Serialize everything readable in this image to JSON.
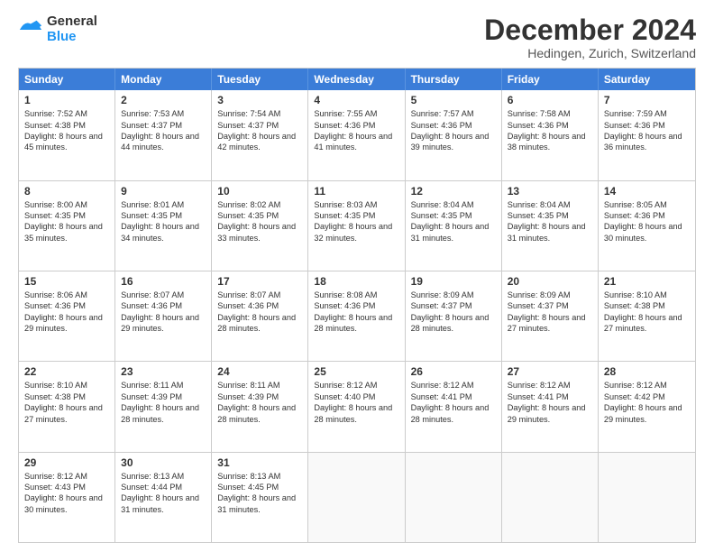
{
  "header": {
    "logo_general": "General",
    "logo_blue": "Blue",
    "month_title": "December 2024",
    "location": "Hedingen, Zurich, Switzerland"
  },
  "days_of_week": [
    "Sunday",
    "Monday",
    "Tuesday",
    "Wednesday",
    "Thursday",
    "Friday",
    "Saturday"
  ],
  "weeks": [
    [
      {
        "day": "1",
        "sunrise": "Sunrise: 7:52 AM",
        "sunset": "Sunset: 4:38 PM",
        "daylight": "Daylight: 8 hours and 45 minutes."
      },
      {
        "day": "2",
        "sunrise": "Sunrise: 7:53 AM",
        "sunset": "Sunset: 4:37 PM",
        "daylight": "Daylight: 8 hours and 44 minutes."
      },
      {
        "day": "3",
        "sunrise": "Sunrise: 7:54 AM",
        "sunset": "Sunset: 4:37 PM",
        "daylight": "Daylight: 8 hours and 42 minutes."
      },
      {
        "day": "4",
        "sunrise": "Sunrise: 7:55 AM",
        "sunset": "Sunset: 4:36 PM",
        "daylight": "Daylight: 8 hours and 41 minutes."
      },
      {
        "day": "5",
        "sunrise": "Sunrise: 7:57 AM",
        "sunset": "Sunset: 4:36 PM",
        "daylight": "Daylight: 8 hours and 39 minutes."
      },
      {
        "day": "6",
        "sunrise": "Sunrise: 7:58 AM",
        "sunset": "Sunset: 4:36 PM",
        "daylight": "Daylight: 8 hours and 38 minutes."
      },
      {
        "day": "7",
        "sunrise": "Sunrise: 7:59 AM",
        "sunset": "Sunset: 4:36 PM",
        "daylight": "Daylight: 8 hours and 36 minutes."
      }
    ],
    [
      {
        "day": "8",
        "sunrise": "Sunrise: 8:00 AM",
        "sunset": "Sunset: 4:35 PM",
        "daylight": "Daylight: 8 hours and 35 minutes."
      },
      {
        "day": "9",
        "sunrise": "Sunrise: 8:01 AM",
        "sunset": "Sunset: 4:35 PM",
        "daylight": "Daylight: 8 hours and 34 minutes."
      },
      {
        "day": "10",
        "sunrise": "Sunrise: 8:02 AM",
        "sunset": "Sunset: 4:35 PM",
        "daylight": "Daylight: 8 hours and 33 minutes."
      },
      {
        "day": "11",
        "sunrise": "Sunrise: 8:03 AM",
        "sunset": "Sunset: 4:35 PM",
        "daylight": "Daylight: 8 hours and 32 minutes."
      },
      {
        "day": "12",
        "sunrise": "Sunrise: 8:04 AM",
        "sunset": "Sunset: 4:35 PM",
        "daylight": "Daylight: 8 hours and 31 minutes."
      },
      {
        "day": "13",
        "sunrise": "Sunrise: 8:04 AM",
        "sunset": "Sunset: 4:35 PM",
        "daylight": "Daylight: 8 hours and 31 minutes."
      },
      {
        "day": "14",
        "sunrise": "Sunrise: 8:05 AM",
        "sunset": "Sunset: 4:36 PM",
        "daylight": "Daylight: 8 hours and 30 minutes."
      }
    ],
    [
      {
        "day": "15",
        "sunrise": "Sunrise: 8:06 AM",
        "sunset": "Sunset: 4:36 PM",
        "daylight": "Daylight: 8 hours and 29 minutes."
      },
      {
        "day": "16",
        "sunrise": "Sunrise: 8:07 AM",
        "sunset": "Sunset: 4:36 PM",
        "daylight": "Daylight: 8 hours and 29 minutes."
      },
      {
        "day": "17",
        "sunrise": "Sunrise: 8:07 AM",
        "sunset": "Sunset: 4:36 PM",
        "daylight": "Daylight: 8 hours and 28 minutes."
      },
      {
        "day": "18",
        "sunrise": "Sunrise: 8:08 AM",
        "sunset": "Sunset: 4:36 PM",
        "daylight": "Daylight: 8 hours and 28 minutes."
      },
      {
        "day": "19",
        "sunrise": "Sunrise: 8:09 AM",
        "sunset": "Sunset: 4:37 PM",
        "daylight": "Daylight: 8 hours and 28 minutes."
      },
      {
        "day": "20",
        "sunrise": "Sunrise: 8:09 AM",
        "sunset": "Sunset: 4:37 PM",
        "daylight": "Daylight: 8 hours and 27 minutes."
      },
      {
        "day": "21",
        "sunrise": "Sunrise: 8:10 AM",
        "sunset": "Sunset: 4:38 PM",
        "daylight": "Daylight: 8 hours and 27 minutes."
      }
    ],
    [
      {
        "day": "22",
        "sunrise": "Sunrise: 8:10 AM",
        "sunset": "Sunset: 4:38 PM",
        "daylight": "Daylight: 8 hours and 27 minutes."
      },
      {
        "day": "23",
        "sunrise": "Sunrise: 8:11 AM",
        "sunset": "Sunset: 4:39 PM",
        "daylight": "Daylight: 8 hours and 28 minutes."
      },
      {
        "day": "24",
        "sunrise": "Sunrise: 8:11 AM",
        "sunset": "Sunset: 4:39 PM",
        "daylight": "Daylight: 8 hours and 28 minutes."
      },
      {
        "day": "25",
        "sunrise": "Sunrise: 8:12 AM",
        "sunset": "Sunset: 4:40 PM",
        "daylight": "Daylight: 8 hours and 28 minutes."
      },
      {
        "day": "26",
        "sunrise": "Sunrise: 8:12 AM",
        "sunset": "Sunset: 4:41 PM",
        "daylight": "Daylight: 8 hours and 28 minutes."
      },
      {
        "day": "27",
        "sunrise": "Sunrise: 8:12 AM",
        "sunset": "Sunset: 4:41 PM",
        "daylight": "Daylight: 8 hours and 29 minutes."
      },
      {
        "day": "28",
        "sunrise": "Sunrise: 8:12 AM",
        "sunset": "Sunset: 4:42 PM",
        "daylight": "Daylight: 8 hours and 29 minutes."
      }
    ],
    [
      {
        "day": "29",
        "sunrise": "Sunrise: 8:12 AM",
        "sunset": "Sunset: 4:43 PM",
        "daylight": "Daylight: 8 hours and 30 minutes."
      },
      {
        "day": "30",
        "sunrise": "Sunrise: 8:13 AM",
        "sunset": "Sunset: 4:44 PM",
        "daylight": "Daylight: 8 hours and 31 minutes."
      },
      {
        "day": "31",
        "sunrise": "Sunrise: 8:13 AM",
        "sunset": "Sunset: 4:45 PM",
        "daylight": "Daylight: 8 hours and 31 minutes."
      },
      {
        "day": "",
        "sunrise": "",
        "sunset": "",
        "daylight": ""
      },
      {
        "day": "",
        "sunrise": "",
        "sunset": "",
        "daylight": ""
      },
      {
        "day": "",
        "sunrise": "",
        "sunset": "",
        "daylight": ""
      },
      {
        "day": "",
        "sunrise": "",
        "sunset": "",
        "daylight": ""
      }
    ]
  ]
}
